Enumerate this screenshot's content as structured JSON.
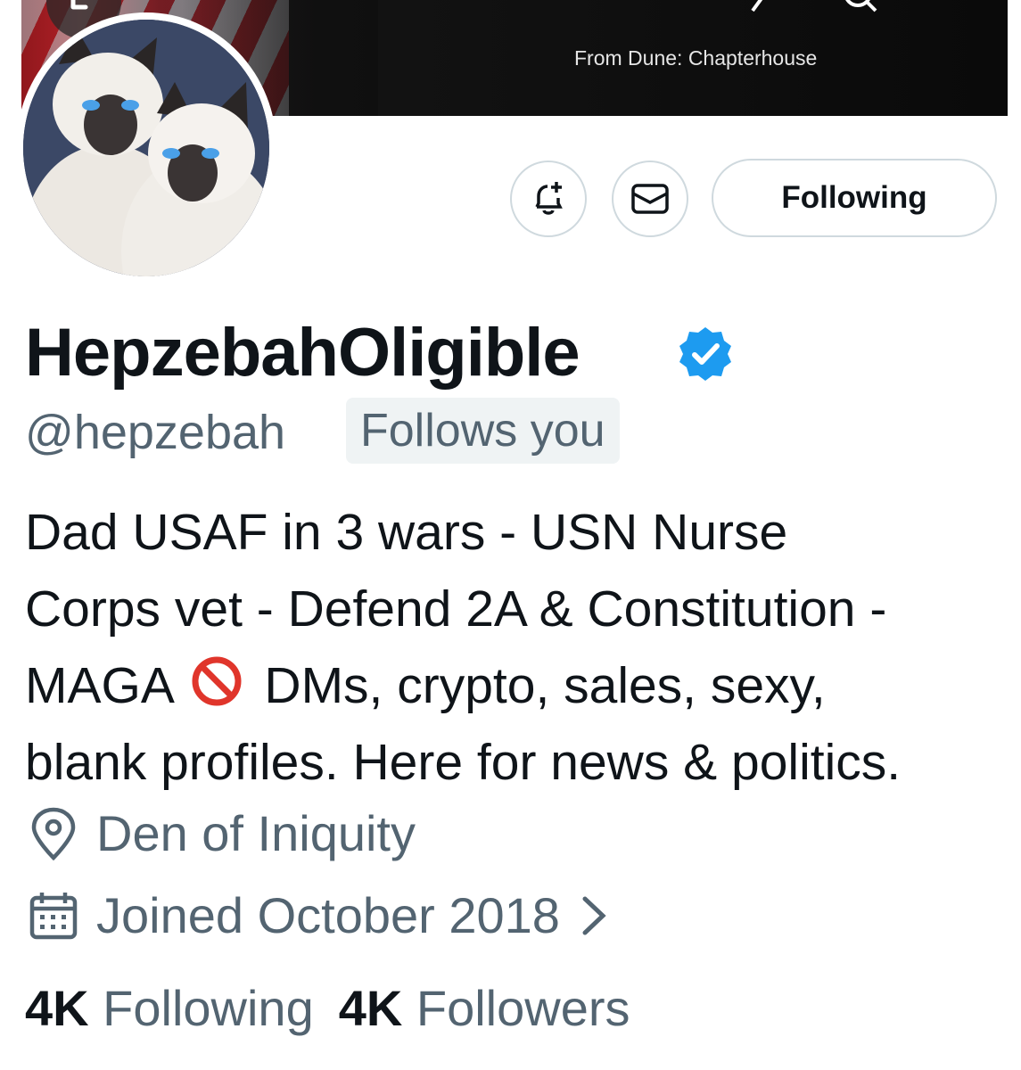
{
  "banner": {
    "caption": "From Dune: Chapterhouse"
  },
  "actions": {
    "follow_label": "Following"
  },
  "profile": {
    "display_name": "HepzebahOligible",
    "handle": "@hepzebah",
    "follows_you": "Follows you",
    "bio_lines": [
      "Dad USAF in 3 wars - USN Nurse",
      "Corps vet - Defend 2A & Constitution -",
      "MAGA",
      "DMs, crypto, sales, sexy,",
      "blank profiles. Here for news & politics."
    ],
    "location": "Den of Iniquity",
    "joined": "Joined October 2018"
  },
  "stats": {
    "following_count": "4K",
    "following_label": "Following",
    "followers_count": "4K",
    "followers_label": "Followers"
  },
  "colors": {
    "accent_verified": "#1d9bf0",
    "muted_text": "#536471",
    "border": "#cfd9de"
  }
}
